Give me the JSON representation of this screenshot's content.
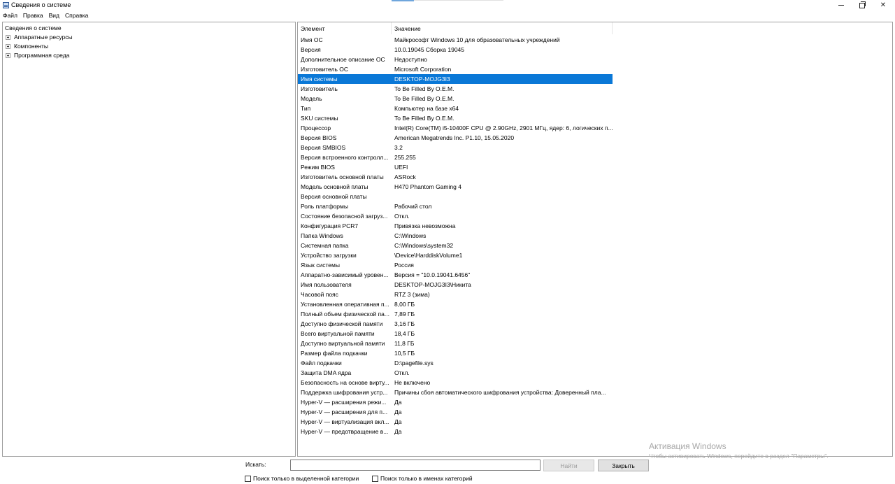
{
  "window": {
    "title": "Сведения о системе",
    "controls": {
      "minimize": "minimize-icon",
      "maximize": "restore-icon",
      "close": "close-icon"
    }
  },
  "menu": [
    "Файл",
    "Правка",
    "Вид",
    "Справка"
  ],
  "tree": {
    "root": "Сведения о системе",
    "nodes": [
      "Аппаратные ресурсы",
      "Компоненты",
      "Программная среда"
    ]
  },
  "list": {
    "columns": [
      "Элемент",
      "Значение"
    ],
    "selected_index": 4,
    "selection_color": "#0a78d7",
    "rows": [
      [
        "Имя ОС",
        "Майкрософт Windows 10 для образовательных учреждений"
      ],
      [
        "Версия",
        "10.0.19045 Сборка 19045"
      ],
      [
        "Дополнительное описание ОС",
        "Недоступно"
      ],
      [
        "Изготовитель ОС",
        "Microsoft Corporation"
      ],
      [
        "Имя системы",
        "DESKTOP-MOJG3I3"
      ],
      [
        "Изготовитель",
        "To Be Filled By O.E.M."
      ],
      [
        "Модель",
        "To Be Filled By O.E.M."
      ],
      [
        "Тип",
        "Компьютер на базе x64"
      ],
      [
        "SKU системы",
        "To Be Filled By O.E.M."
      ],
      [
        "Процессор",
        "Intel(R) Core(TM) i5-10400F CPU @ 2.90GHz, 2901 МГц, ядер: 6, логических п..."
      ],
      [
        "Версия BIOS",
        "American Megatrends Inc. P1.10, 15.05.2020"
      ],
      [
        "Версия SMBIOS",
        "3.2"
      ],
      [
        "Версия встроенного контролл...",
        "255.255"
      ],
      [
        "Режим BIOS",
        "UEFI"
      ],
      [
        "Изготовитель основной платы",
        "ASRock"
      ],
      [
        "Модель основной платы",
        "H470 Phantom Gaming 4"
      ],
      [
        "Версия основной платы",
        ""
      ],
      [
        "Роль платформы",
        "Рабочий стол"
      ],
      [
        "Состояние безопасной загруз...",
        "Откл."
      ],
      [
        "Конфигурация PCR7",
        "Привязка невозможна"
      ],
      [
        "Папка Windows",
        "C:\\Windows"
      ],
      [
        "Системная папка",
        "C:\\Windows\\system32"
      ],
      [
        "Устройство загрузки",
        "\\Device\\HarddiskVolume1"
      ],
      [
        "Язык системы",
        "Россия"
      ],
      [
        "Аппаратно-зависимый уровен...",
        "Версия = \"10.0.19041.6456\""
      ],
      [
        "Имя пользователя",
        "DESKTOP-MOJG3I3\\Никита"
      ],
      [
        "Часовой пояс",
        "RTZ 3 (зима)"
      ],
      [
        "Установленная оперативная п...",
        "8,00 ГБ"
      ],
      [
        "Полный объем физической па...",
        "7,89 ГБ"
      ],
      [
        "Доступно физической памяти",
        "3,16 ГБ"
      ],
      [
        "Всего виртуальной памяти",
        "18,4 ГБ"
      ],
      [
        "Доступно виртуальной памяти",
        "11,8 ГБ"
      ],
      [
        "Размер файла подкачки",
        "10,5 ГБ"
      ],
      [
        "Файл подкачки",
        "D:\\pagefile.sys"
      ],
      [
        "Защита DMA ядра",
        "Откл."
      ],
      [
        "Безопасность на основе вирту...",
        "Не включено"
      ],
      [
        "Поддержка шифрования устр...",
        "Причины сбоя автоматического шифрования устройства: Доверенный пла..."
      ],
      [
        "Hyper-V — расширения режи...",
        "Да"
      ],
      [
        "Hyper-V — расширения для п...",
        "Да"
      ],
      [
        "Hyper-V — виртуализация вкл...",
        "Да"
      ],
      [
        "Hyper-V — предотвращение в...",
        "Да"
      ]
    ]
  },
  "watermark": {
    "title": "Активация Windows",
    "subtitle": "Чтобы активировать Windows, перейдите в раздел \"Параметры\"."
  },
  "search": {
    "label": "Искать:",
    "value": "",
    "find_button": "Найти",
    "close_button": "Закрыть",
    "check_selected_category": "Поиск только в выделенной категории",
    "check_category_names": "Поиск только в именах категорий"
  }
}
